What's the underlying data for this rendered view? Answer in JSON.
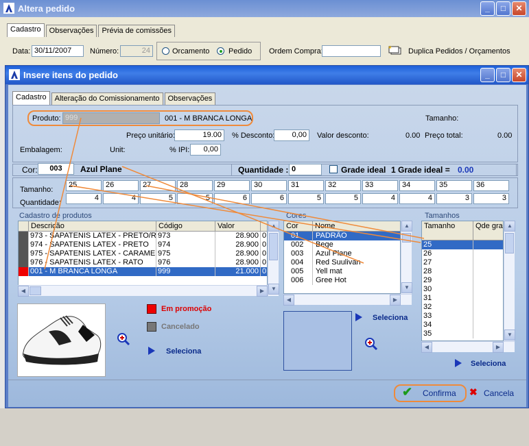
{
  "main_window": {
    "title": "Altera pedido",
    "tabs": [
      "Cadastro",
      "Observações",
      "Prévia de comissões"
    ],
    "data_label": "Data:",
    "data_value": "30/11/2007",
    "numero_label": "Número:",
    "numero_value": "24",
    "radio_orcamento": "Orcamento",
    "radio_pedido": "Pedido",
    "ordem_label": "Ordem Compra:",
    "ordem_value": "",
    "duplica_label": "Duplica Pedidos / Orçamentos"
  },
  "dialog": {
    "title": "Insere itens do pedido",
    "tabs": [
      "Cadastro",
      "Alteração do Comissionamento",
      "Observações"
    ],
    "produto_label": "Produto:",
    "produto_code": "999",
    "produto_desc": "001 - M BRANCA LONGA",
    "tamanho_label": "Tamanho:",
    "preco_label": "Preço unitário:",
    "preco_value": "19.00",
    "desconto_label": "% Desconto:",
    "desconto_value": "0,00",
    "valor_desconto_label": "Valor desconto:",
    "valor_desconto_value": "0.00",
    "preco_total_label": "Preço total:",
    "preco_total_value": "0.00",
    "embalagem_label": "Embalagem:",
    "unit_label": "Unit:",
    "ipi_label": "% IPI:",
    "ipi_value": "0,00",
    "cor_label": "Cor:",
    "cor_code": "003",
    "cor_name": "Azul Plane",
    "quantidade_label": "Quantidade :",
    "quantidade_value": "0",
    "grade_ideal_label": "Grade ideal",
    "grade_ideal_text": "1 Grade ideal =",
    "grade_ideal_value": "0.00",
    "tamanho_row_label": "Tamanho:",
    "quantidade_row_label": "Quantidade:",
    "sizes": [
      "25",
      "26",
      "27",
      "28",
      "29",
      "30",
      "31",
      "32",
      "33",
      "34",
      "35",
      "36"
    ],
    "quantities": [
      "4",
      "4",
      "5",
      "5",
      "6",
      "6",
      "5",
      "5",
      "4",
      "4",
      "3",
      "3"
    ]
  },
  "produtos": {
    "group_label": "Cadastro de produtos",
    "headers": [
      "Descrição",
      "Código",
      "Valor"
    ],
    "rows": [
      {
        "desc": "973 - SAPATENIS LATEX - PRETO/R",
        "code": "973",
        "valor": "28.900",
        "extra": "0"
      },
      {
        "desc": "974 - SAPATENIS LATEX - PRETO",
        "code": "974",
        "valor": "28.900",
        "extra": "0"
      },
      {
        "desc": "975 - SAPATENIS LATEX - CARAMEL",
        "code": "975",
        "valor": "28.900",
        "extra": "0"
      },
      {
        "desc": "976 - SAPATENIS LATEX - RATO",
        "code": "976",
        "valor": "28.900",
        "extra": "0"
      },
      {
        "desc": "001 - M BRANCA LONGA",
        "code": "999",
        "valor": "21.000",
        "extra": "0"
      }
    ],
    "promo_label": "Em promoção",
    "cancelado_label": "Cancelado",
    "seleciona_label": "Seleciona"
  },
  "cores": {
    "group_label": "Cores",
    "headers": [
      "Cor",
      "Nome"
    ],
    "rows": [
      {
        "code": "01",
        "name": "PADRÃO"
      },
      {
        "code": "002",
        "name": "Bege"
      },
      {
        "code": "003",
        "name": "Azul Plane"
      },
      {
        "code": "004",
        "name": "Red Suulivan"
      },
      {
        "code": "005",
        "name": "Yell mat"
      },
      {
        "code": "006",
        "name": "Gree Hot"
      }
    ],
    "seleciona_label": "Seleciona"
  },
  "tamanhos": {
    "group_label": "Tamanhos",
    "headers": [
      "Tamanho",
      "Qde grade id"
    ],
    "rows": [
      "25",
      "26",
      "27",
      "28",
      "29",
      "30",
      "31",
      "32",
      "33",
      "34",
      "35"
    ],
    "seleciona_label": "Seleciona"
  },
  "footer": {
    "confirma_label": "Confirma",
    "cancela_label": "Cancela"
  },
  "colors": {
    "selection": "#316ac5",
    "highlight": "#ef8a3a",
    "title_active": "#2257c8"
  }
}
